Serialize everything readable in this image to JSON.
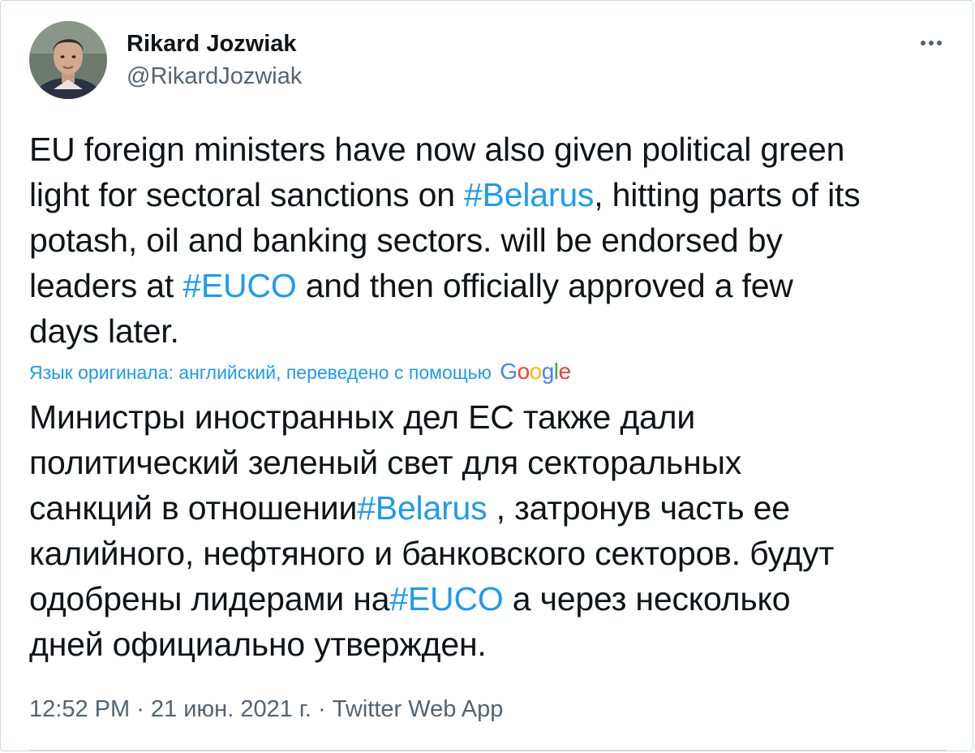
{
  "author": {
    "name": "Rikard Jozwiak",
    "handle": "@RikardJozwiak",
    "avatar_icon": "profile-photo"
  },
  "menu": {
    "more_icon": "more-horizontal-icon"
  },
  "tweet": {
    "lines": [
      [
        {
          "text": "EU foreign ministers have now also given political green"
        }
      ],
      [
        {
          "text": "light for sectoral sanctions on "
        },
        {
          "text": "#Belarus",
          "hashtag": true
        },
        {
          "text": ", hitting parts of its"
        }
      ],
      [
        {
          "text": "potash, oil and banking sectors. will be endorsed by"
        }
      ],
      [
        {
          "text": "leaders at "
        },
        {
          "text": "#EUCO",
          "hashtag": true
        },
        {
          "text": " and then officially approved a few"
        }
      ],
      [
        {
          "text": "days later."
        }
      ]
    ]
  },
  "translation": {
    "note": "Язык оригинала: английский, переведено с помощью",
    "provider": "Google",
    "lines": [
      [
        {
          "text": "Министры иностранных дел ЕС также дали"
        }
      ],
      [
        {
          "text": "политический зеленый свет для секторальных"
        }
      ],
      [
        {
          "text": "санкций в отношении"
        },
        {
          "text": "#Belarus",
          "hashtag": true
        },
        {
          "text": " , затронув часть ее"
        }
      ],
      [
        {
          "text": "калийного, нефтяного и банковского секторов. будут"
        }
      ],
      [
        {
          "text": "одобрены лидерами на"
        },
        {
          "text": "#EUCO",
          "hashtag": true
        },
        {
          "text": " а через несколько"
        }
      ],
      [
        {
          "text": "дней официально утвержден."
        }
      ]
    ]
  },
  "meta": {
    "time": "12:52 PM",
    "separator": " · ",
    "date": "21 июн. 2021 г.",
    "source": "Twitter Web App"
  },
  "colors": {
    "link": "#1d9bf0",
    "text": "#0f1419",
    "secondary": "#536471",
    "border": "#cfd9de"
  }
}
